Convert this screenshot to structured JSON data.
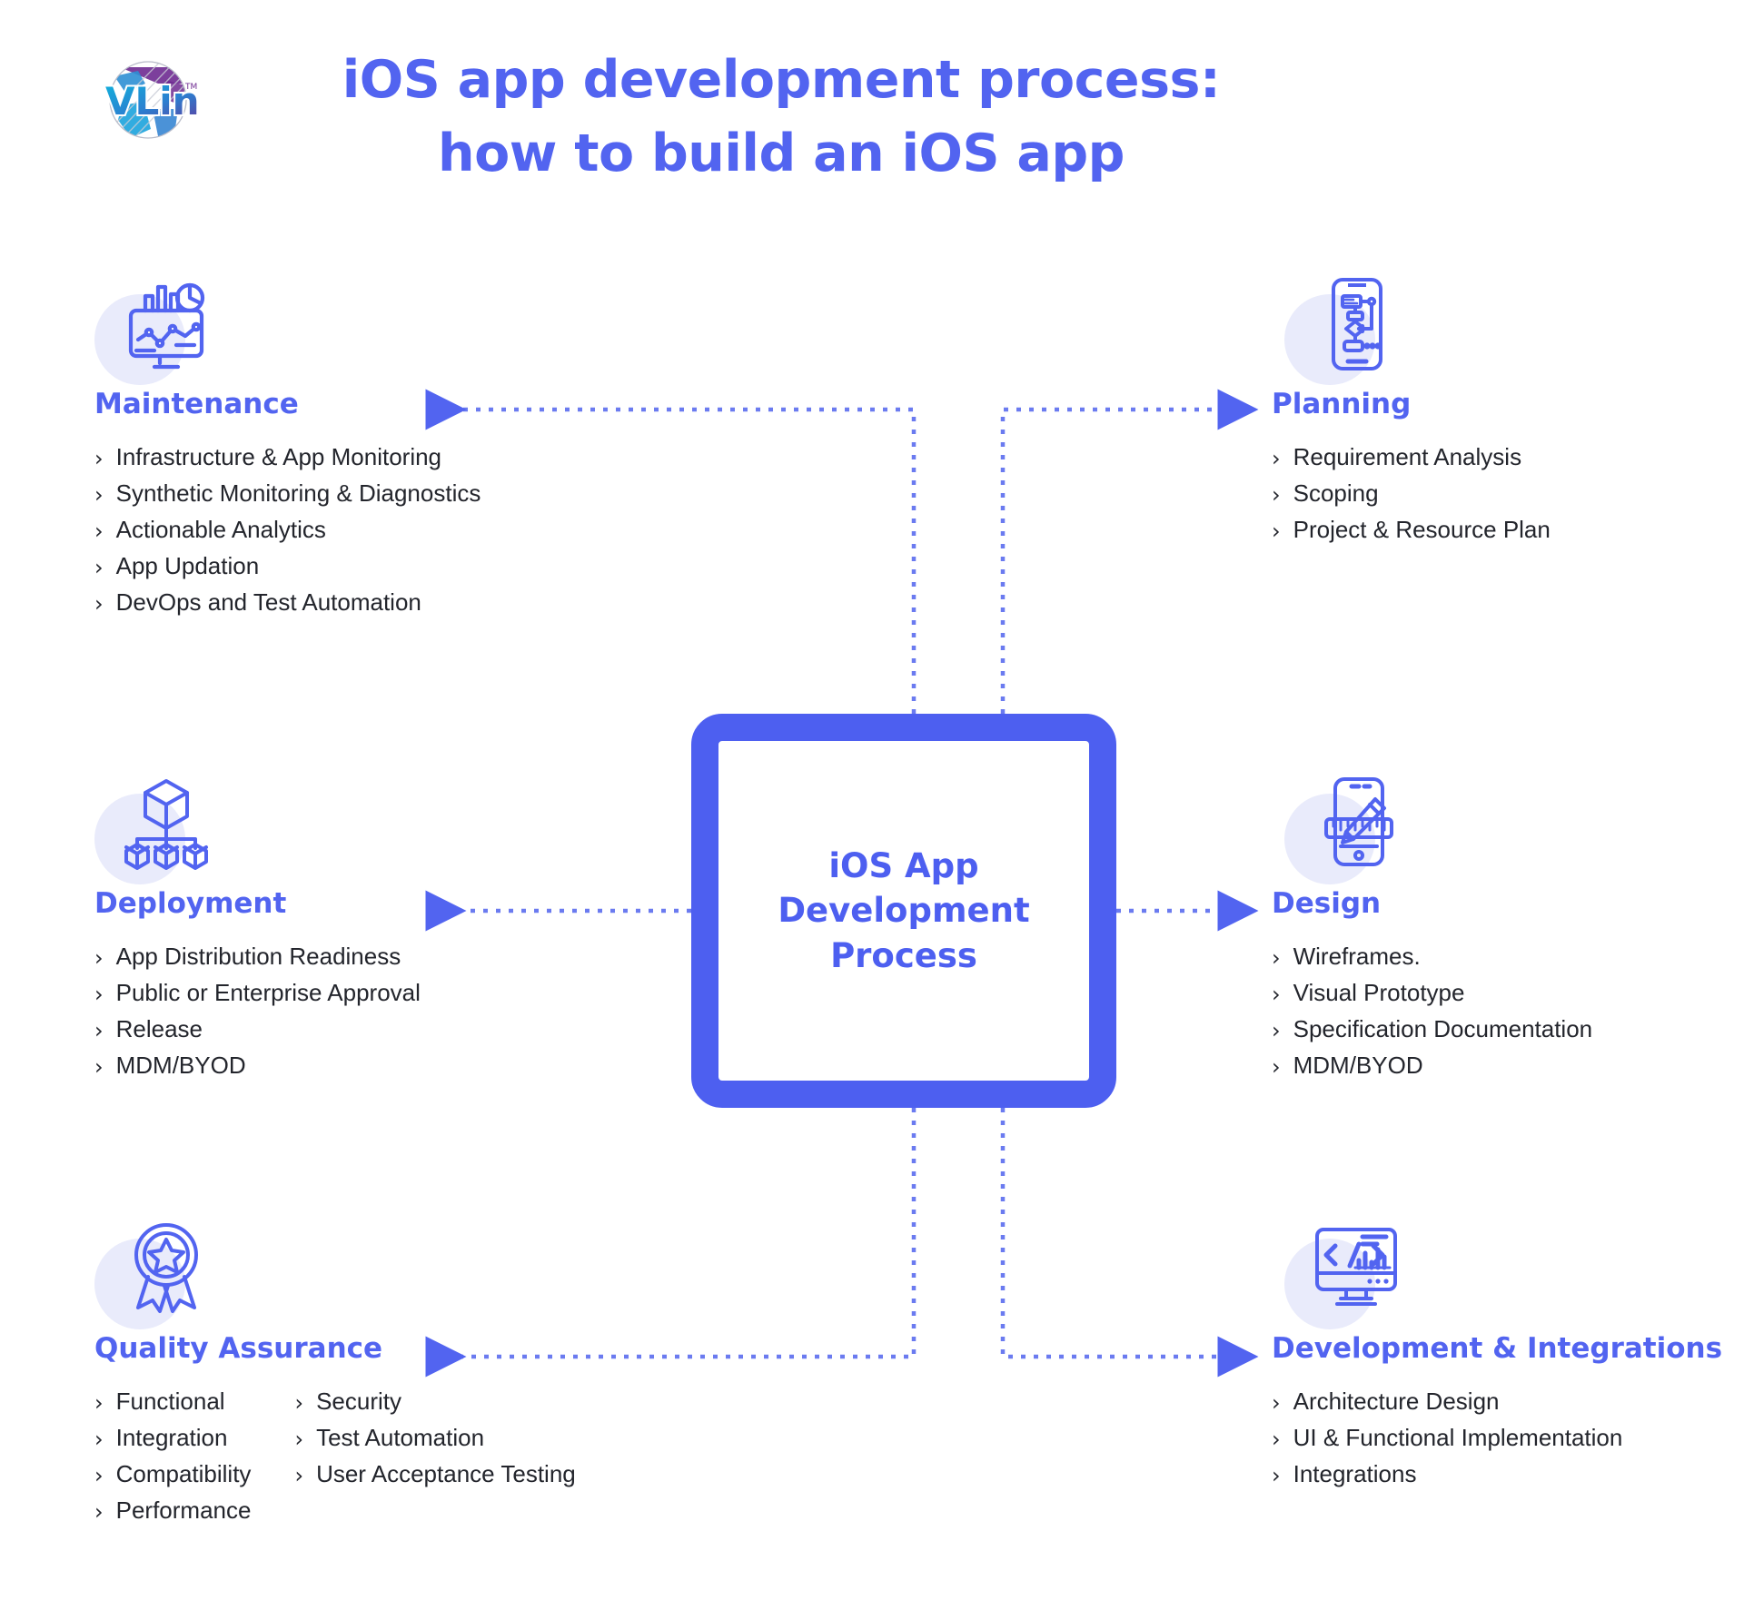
{
  "brand": {
    "logo_name": "VLink",
    "logo_mark": "globe-logo",
    "trademark": "TM"
  },
  "header": {
    "title_line1": "iOS app development process:",
    "title_line2": "how to build an iOS app"
  },
  "center": {
    "line1": "iOS App",
    "line2": "Development",
    "line3": "Process"
  },
  "colors": {
    "accent": "#4d5ff0",
    "accent_title": "#5264f0",
    "halo": "#e9ebfb",
    "text": "#23252c",
    "connector": "#6b7bf0"
  },
  "bullet_glyph": "›",
  "blocks": [
    {
      "id": "maintenance",
      "title": "Maintenance",
      "icon": "analytics-monitor-icon",
      "side": "left",
      "columns": [
        [
          "Infrastructure & App Monitoring",
          "Synthetic Monitoring & Diagnostics",
          "Actionable Analytics",
          "App Updation",
          "DevOps and Test Automation"
        ]
      ]
    },
    {
      "id": "deployment",
      "title": "Deployment",
      "icon": "cube-hierarchy-icon",
      "side": "left",
      "columns": [
        [
          "App Distribution Readiness",
          "Public or Enterprise Approval",
          "Release",
          "MDM/BYOD"
        ]
      ]
    },
    {
      "id": "quality-assurance",
      "title": "Quality Assurance",
      "icon": "award-medal-icon",
      "side": "left",
      "columns": [
        [
          "Functional",
          "Integration",
          "Compatibility",
          "Performance"
        ],
        [
          "Security",
          "Test Automation",
          "User Acceptance Testing"
        ]
      ]
    },
    {
      "id": "planning",
      "title": "Planning",
      "icon": "phone-flowchart-icon",
      "side": "right",
      "columns": [
        [
          "Requirement Analysis",
          "Scoping",
          "Project & Resource Plan"
        ]
      ]
    },
    {
      "id": "design",
      "title": "Design",
      "icon": "phone-pencil-ruler-icon",
      "side": "right",
      "columns": [
        [
          "Wireframes.",
          "Visual Prototype",
          "Specification Documentation",
          "MDM/BYOD"
        ]
      ]
    },
    {
      "id": "development-integrations",
      "title": "Development & Integrations",
      "icon": "code-monitor-icon",
      "side": "right",
      "columns": [
        [
          "Architecture Design",
          "UI & Functional Implementation",
          "Integrations"
        ]
      ]
    }
  ]
}
